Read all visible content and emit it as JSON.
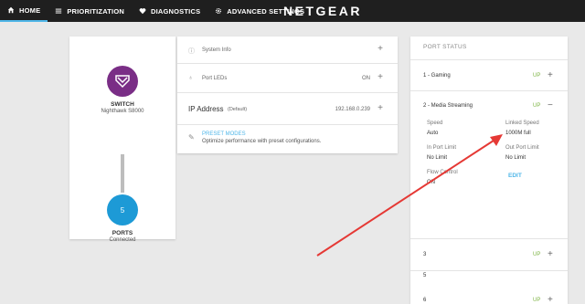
{
  "nav": {
    "items": [
      {
        "label": "HOME",
        "icon": "home-icon",
        "active": true
      },
      {
        "label": "PRIORITIZATION",
        "icon": "menu-icon",
        "active": false
      },
      {
        "label": "DIAGNOSTICS",
        "icon": "heart-icon",
        "active": false
      },
      {
        "label": "ADVANCED SETTINGS",
        "icon": "gear-icon",
        "active": false
      }
    ],
    "brand": "NETGEAR"
  },
  "device": {
    "switch_title": "SWITCH",
    "switch_model": "Nighthawk S8000",
    "ports_count": "5",
    "ports_title": "PORTS",
    "ports_status": "Connected"
  },
  "settings": {
    "system_info": "System Info",
    "port_leds": "Port LEDs",
    "port_leds_value": "ON",
    "ip_label": "IP Address",
    "ip_default": "(Default)",
    "ip_value": "192.168.0.239",
    "preset_title": "PRESET MODES",
    "preset_desc": "Optimize performance with preset configurations."
  },
  "port_status": {
    "header": "PORT STATUS",
    "ports": [
      {
        "name": "1 - Gaming",
        "status": "UP",
        "toggle": "+"
      },
      {
        "name": "2 - Media Streaming",
        "status": "UP",
        "toggle": "−"
      },
      {
        "name": "3",
        "status": "UP",
        "toggle": "+"
      },
      {
        "name": "4",
        "status": "",
        "toggle": ""
      },
      {
        "name": "5",
        "status": "",
        "toggle": ""
      },
      {
        "name": "6",
        "status": "UP",
        "toggle": "+"
      }
    ],
    "details": {
      "speed_label": "Speed",
      "speed_value": "Auto",
      "linked_label": "Linked Speed",
      "linked_value": "1000M full",
      "in_limit_label": "In Port Limit",
      "in_limit_value": "No Limit",
      "out_limit_label": "Out Port Limit",
      "out_limit_value": "No Limit",
      "flow_label": "Flow Control",
      "flow_value": "ON",
      "edit_label": "EDIT"
    }
  },
  "colors": {
    "accent": "#4fb6e8",
    "switch_circle": "#7a2e86",
    "ports_circle": "#1d9ad6",
    "up_status": "#7cb342",
    "annotation_arrow": "#e53935"
  }
}
